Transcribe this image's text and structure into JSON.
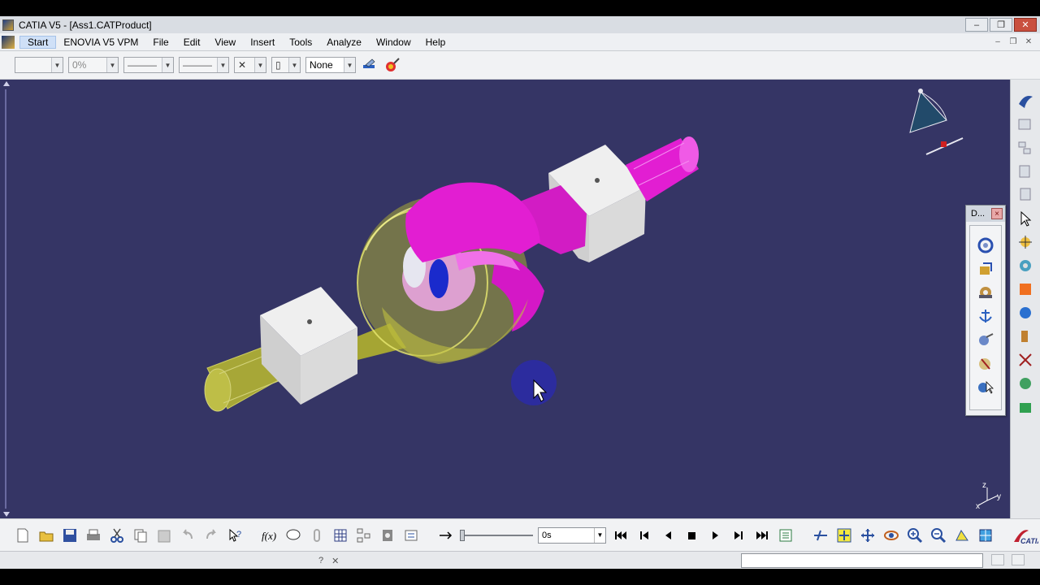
{
  "window": {
    "title": "CATIA V5 - [Ass1.CATProduct]",
    "controls": [
      "–",
      "❐",
      "✕"
    ]
  },
  "menubar": {
    "items": [
      "Start",
      "ENOVIA V5 VPM",
      "File",
      "Edit",
      "View",
      "Insert",
      "Tools",
      "Analyze",
      "Window",
      "Help"
    ],
    "mdi_controls": [
      "–",
      "❐",
      "✕"
    ]
  },
  "properties_toolbar": {
    "color_value": "",
    "transparency_value": "0%",
    "line_thickness_value": "———",
    "line_type_value": "———",
    "point_symbol_value": "✕",
    "layer_value": "None"
  },
  "floating_toolbar": {
    "title": "D...",
    "close": "×"
  },
  "simulation_player": {
    "time_value": "0s"
  },
  "compass": {
    "axis_labels": [
      "z",
      "y",
      "x"
    ]
  },
  "status": {
    "text": ""
  },
  "colors": {
    "viewport_bg": "#353565",
    "part_magenta": "#e21ed2",
    "part_yellow": "#c8c832",
    "block_white": "#d8d8d8",
    "accent_blue": "#1a2acc"
  },
  "icons": {
    "properties": [
      "painter-icon",
      "quick-select-icon"
    ],
    "right_toolbar": [
      "catia-logo-icon",
      "product-icon",
      "tree-icon",
      "pointer-icon",
      "select-icon",
      "constraint-icon",
      "manipulation-icon",
      "part-icon",
      "snap-icon",
      "tools-icon",
      "explode-icon",
      "publish-icon"
    ],
    "floating_toolbar": [
      "rotate-icon",
      "move-icon",
      "gear-icon",
      "anchor-icon",
      "compass-icon",
      "collision-icon",
      "pointer-move-icon"
    ],
    "bottom_toolbar": [
      "new-icon",
      "open-icon",
      "save-icon",
      "print-icon",
      "cut-icon",
      "copy-icon",
      "paste-icon",
      "undo-icon",
      "redo-icon",
      "whats-this-icon",
      "formula-icon",
      "comment-icon",
      "link-icon",
      "grid-icon",
      "tree-expand-icon",
      "catalog-icon",
      "measure-icon",
      "arrow-icon",
      "first-frame-icon",
      "prev-step-icon",
      "play-back-icon",
      "stop-icon",
      "play-icon",
      "next-step-icon",
      "last-frame-icon",
      "player-settings-icon",
      "fly-icon",
      "fit-all-icon",
      "pan-icon",
      "rotate-view-icon",
      "zoom-in-icon",
      "zoom-out-icon",
      "normal-view-icon",
      "iso-view-icon",
      "3ds-logo-icon"
    ]
  }
}
